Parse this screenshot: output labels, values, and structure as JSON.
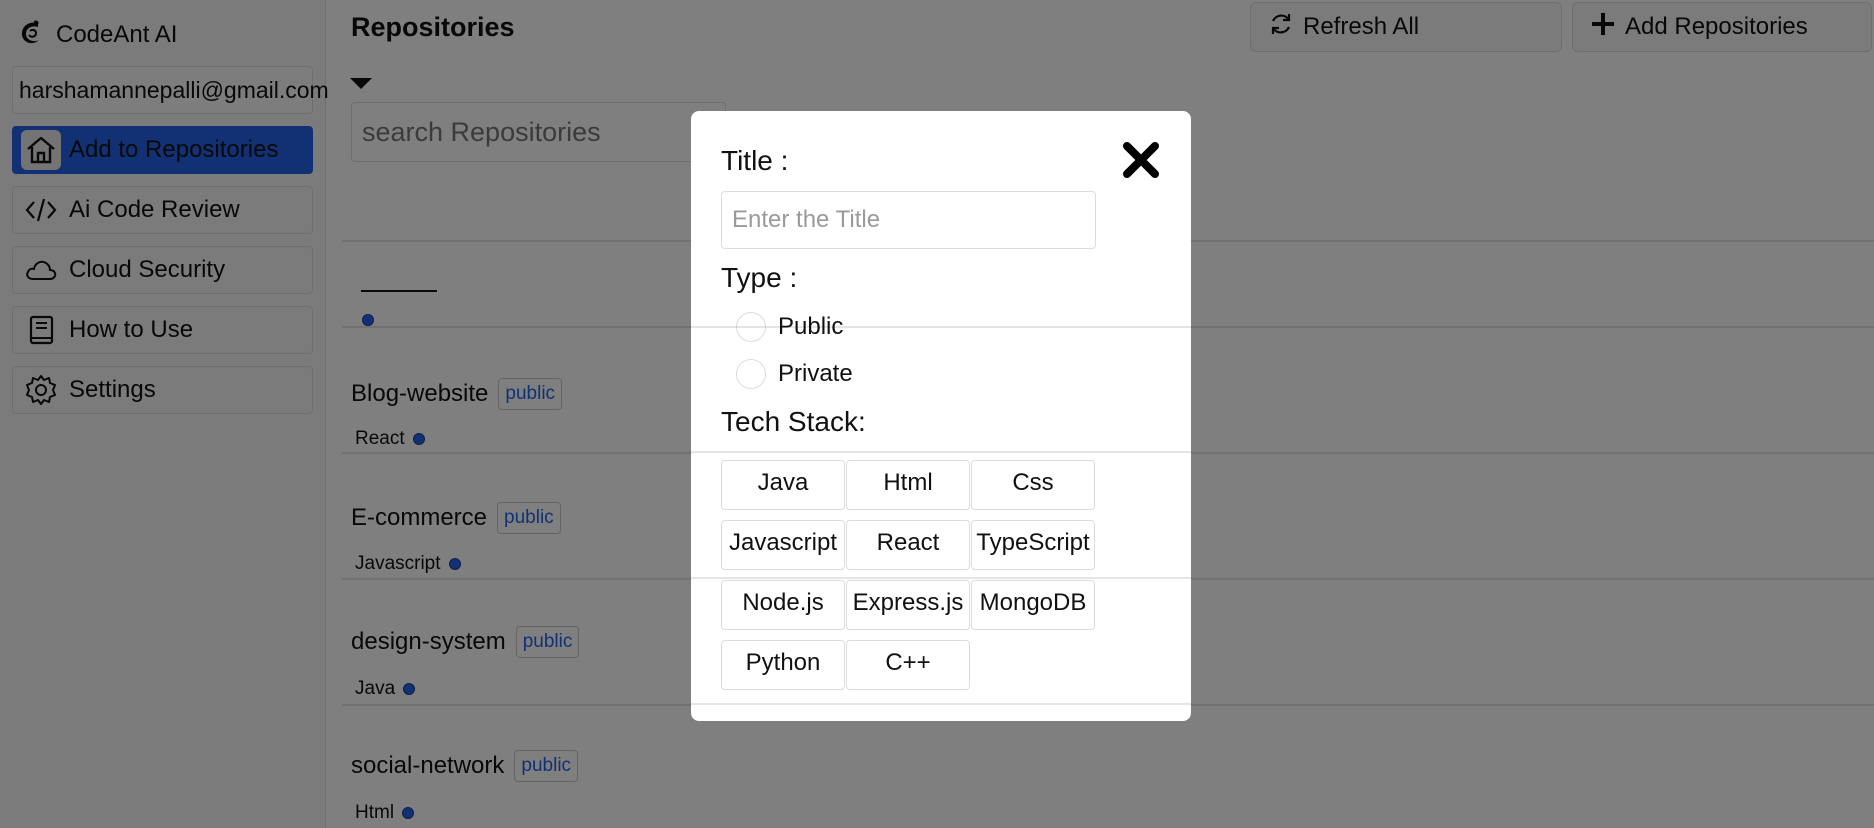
{
  "sidebar": {
    "brand": "CodeAnt AI",
    "email": "harshamannepalli@gmail.com",
    "items": [
      {
        "label": "Add to Repositories",
        "icon": "home-icon",
        "active": true
      },
      {
        "label": "Ai Code Review",
        "icon": "code-icon"
      },
      {
        "label": "Cloud Security",
        "icon": "cloud-icon"
      },
      {
        "label": "How to Use",
        "icon": "book-icon"
      },
      {
        "label": "Settings",
        "icon": "gear-icon"
      }
    ]
  },
  "header": {
    "title": "Repositories",
    "refresh_label": "Refresh All",
    "add_label": "Add Repositories"
  },
  "search": {
    "placeholder": "search Repositories"
  },
  "repos": [
    {
      "name": "Blog-website",
      "visibility": "public",
      "tech": "React"
    },
    {
      "name": "E-commerce",
      "visibility": "public",
      "tech": "Javascript"
    },
    {
      "name": "design-system",
      "visibility": "public",
      "tech": "Java"
    },
    {
      "name": "social-network",
      "visibility": "public",
      "tech": "Html"
    }
  ],
  "modal": {
    "title_label": "Title :",
    "title_placeholder": "Enter the Title",
    "type_label": "Type :",
    "type_options": [
      "Public",
      "Private"
    ],
    "tech_label": "Tech Stack:",
    "tech_options": [
      "Java",
      "Html",
      "Css",
      "Javascript",
      "React",
      "TypeScript",
      "Node.js",
      "Express.js",
      "MongoDB",
      "Python",
      "C++"
    ]
  },
  "colors": {
    "accent": "#2563eb",
    "overlay": "rgba(0,0,0,0.5)"
  }
}
